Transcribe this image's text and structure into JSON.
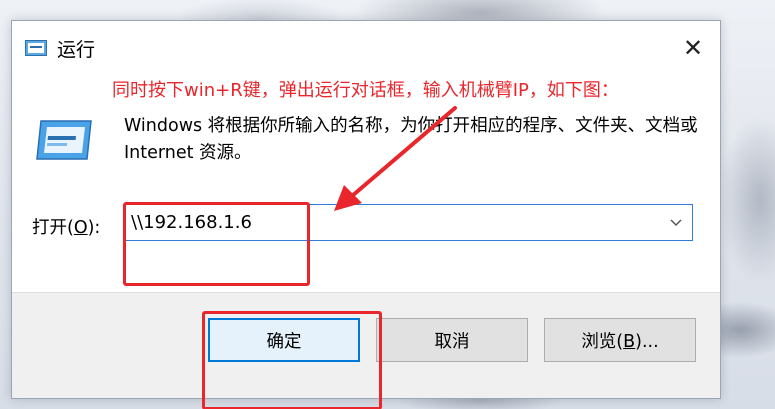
{
  "window": {
    "title": "运行",
    "close_glyph": "✕"
  },
  "annotation": {
    "text": "同时按下win+R键，弹出运行对话框，输入机械臂IP，如下图：",
    "color": "#e8262b"
  },
  "description": "Windows 将根据你所输入的名称，为你打开相应的程序、文件夹、文档或 Internet 资源。",
  "open_field": {
    "label_prefix": "打开(",
    "label_key": "O",
    "label_suffix": "):",
    "value": "\\\\192.168.1.6"
  },
  "buttons": {
    "ok": "确定",
    "cancel": "取消",
    "browse_prefix": "浏览(",
    "browse_key": "B",
    "browse_suffix": ")..."
  },
  "icons": {
    "title": "run-icon",
    "big": "run-icon",
    "dropdown": "chevron-down-icon",
    "close": "close-icon"
  },
  "colors": {
    "accent": "#0078d7",
    "highlight": "#e8262b"
  }
}
